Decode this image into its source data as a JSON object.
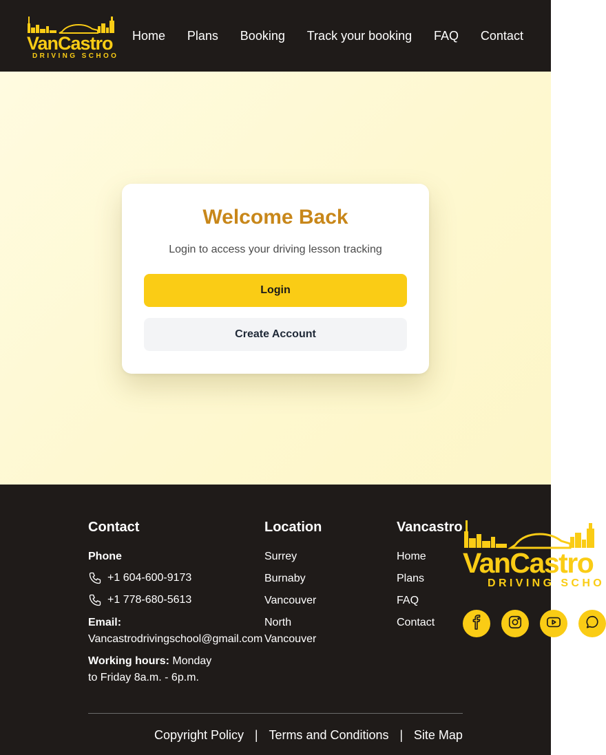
{
  "brand": {
    "name": "VanCastro",
    "tagline": "DRIVING SCHOOL",
    "primary_color": "#facc15",
    "dark_color": "#1f1b19",
    "title_color": "#c8871a"
  },
  "nav": {
    "items": [
      "Home",
      "Plans",
      "Booking",
      "Track your booking",
      "FAQ",
      "Contact"
    ]
  },
  "card": {
    "title": "Welcome Back",
    "subtitle": "Login to access your driving lesson tracking",
    "login_label": "Login",
    "create_label": "Create Account"
  },
  "footer": {
    "contact": {
      "heading": "Contact",
      "phone_label": "Phone",
      "phones": [
        "+1 604-600-9173",
        "+1 778-680-5613"
      ],
      "email_label": "Email:",
      "email": "Vancastrodrivingschool@gmail.com",
      "hours_label": "Working hours:",
      "hours_line1": "Monday",
      "hours_line2": "to Friday 8a.m. - 6p.m."
    },
    "location": {
      "heading": "Location",
      "items": [
        "Surrey",
        "Burnaby",
        "Vancouver",
        "North",
        "Vancouver"
      ]
    },
    "vancastro": {
      "heading": "Vancastro",
      "links": [
        "Home",
        "Plans",
        "FAQ",
        "Contact"
      ]
    },
    "legal": {
      "copyright": "Copyright Policy",
      "terms": "Terms and Conditions",
      "sitemap": "Site Map",
      "separator": "|"
    },
    "social_icons": [
      "facebook-icon",
      "instagram-icon",
      "youtube-icon",
      "chat-icon"
    ]
  }
}
